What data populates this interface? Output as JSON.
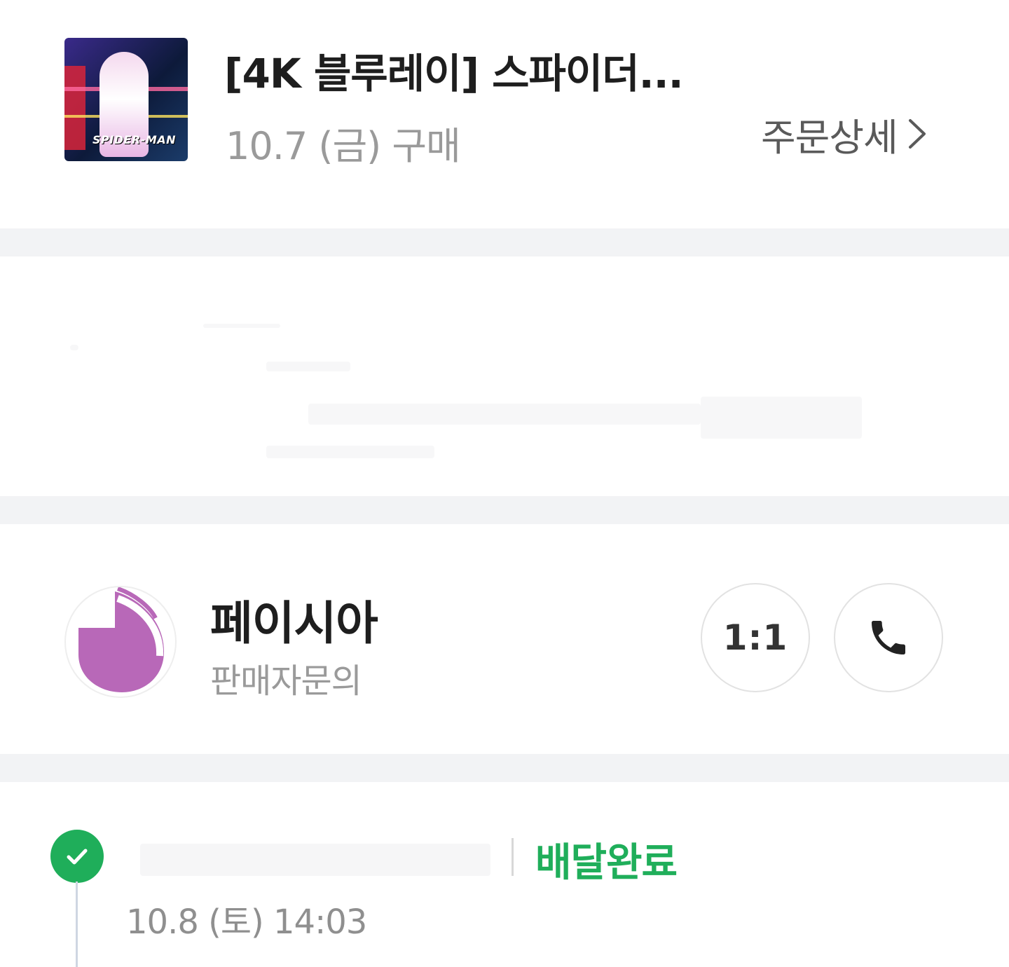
{
  "product": {
    "title": "[4K 블루레이] 스파이더...",
    "purchase_date": "10.7 (금) 구매",
    "detail_link_label": "주문상세",
    "thumbnail_icon": "bluray-cover-image"
  },
  "seller": {
    "name": "페이시아",
    "subtitle": "판매자문의",
    "avatar_icon": "seller-logo-drop",
    "avatar_color": "#b868b8",
    "chat_button_label": "1:1",
    "call_button_icon": "phone-icon"
  },
  "tracking": {
    "status": "배달완료",
    "status_color": "#1fae5a",
    "time": "10.8 (토) 14:03",
    "check_icon": "check-icon"
  }
}
